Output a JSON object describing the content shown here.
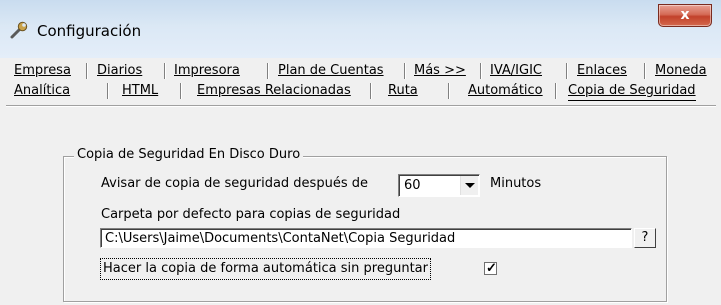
{
  "window": {
    "title": "Configuración",
    "close_label": "x"
  },
  "tabs": {
    "row1": [
      {
        "label": "Empresa",
        "active": false
      },
      {
        "label": "Diarios",
        "active": false
      },
      {
        "label": "Impresora",
        "active": false
      },
      {
        "label": "Plan de Cuentas",
        "active": false
      },
      {
        "label": "Más >>",
        "active": false
      },
      {
        "label": "IVA/IGIC",
        "active": false
      },
      {
        "label": "Enlaces",
        "active": false
      },
      {
        "label": "Moneda",
        "active": false
      }
    ],
    "row2": [
      {
        "label": "Analítica",
        "active": false
      },
      {
        "label": "HTML",
        "active": false
      },
      {
        "label": "Empresas Relacionadas",
        "active": false
      },
      {
        "label": "Ruta",
        "active": false
      },
      {
        "label": "Automático",
        "active": false
      },
      {
        "label": "Copia de Seguridad",
        "active": true
      }
    ]
  },
  "backup_group": {
    "legend": "Copia de Seguridad En Disco Duro",
    "notify_label": "Avisar de copia de seguridad después de",
    "notify_value": "60",
    "notify_unit": "Minutos",
    "folder_label": "Carpeta por defecto para copias de seguridad",
    "folder_value": "C:\\Users\\Jaime\\Documents\\ContaNet\\Copia Seguridad",
    "browse_label": "?",
    "auto_label": "Hacer la copia de forma automática sin preguntar",
    "auto_checked": true
  },
  "colors": {
    "title_bar": "#dbe8f5",
    "close_button": "#c2412a",
    "dialog_bg": "#f0f0f0"
  },
  "icons": {
    "app": "wrench-icon",
    "close": "close-icon",
    "dropdown": "chevron-down-icon",
    "check": "checkmark-icon"
  }
}
